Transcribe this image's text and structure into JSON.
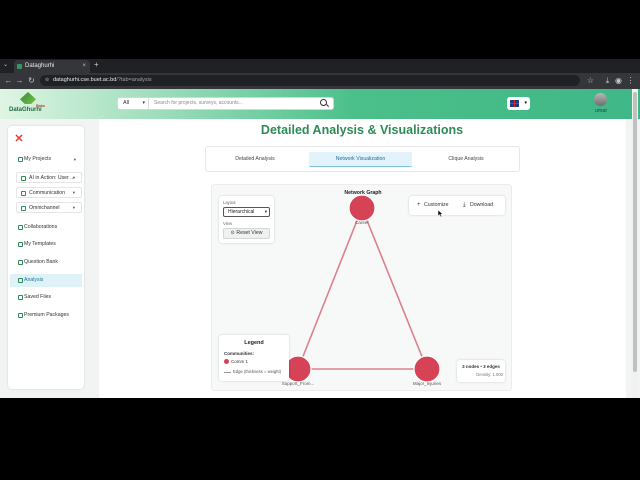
{
  "browser": {
    "tab_title": "Dataghurhi",
    "url_host": "dataghurhi.cse.buet.ac.bd",
    "url_path": "/?tab=analysis",
    "new_tab": "+"
  },
  "header": {
    "logo_name": "DataGhurhi",
    "logo_beta": "Beta",
    "search_category": "All",
    "search_placeholder": "Search for projects, surveys, accounts...",
    "username": "umar"
  },
  "sidebar": {
    "items": [
      {
        "label": "My Projects",
        "icon": "folder-icon",
        "dropdown": true
      },
      {
        "label": "AI in Action: User ...",
        "icon": "folder-icon",
        "dropdown": true,
        "sub": true
      },
      {
        "label": "Communication",
        "icon": "folder-icon",
        "dropdown": true,
        "sub": true
      },
      {
        "label": "Omnichannel",
        "icon": "folder-icon",
        "dropdown": true,
        "sub": true
      },
      {
        "label": "Collaborations",
        "icon": "users-icon"
      },
      {
        "label": "My Templates",
        "icon": "template-icon"
      },
      {
        "label": "Question Bank",
        "icon": "bank-icon"
      },
      {
        "label": "Analysis",
        "icon": "chart-icon",
        "active": true
      },
      {
        "label": "Saved Files",
        "icon": "file-icon"
      },
      {
        "label": "Premium Packages",
        "icon": "crown-icon"
      }
    ]
  },
  "main": {
    "title": "Detailed Analysis & Visualizations",
    "tabs": [
      {
        "label": "Detailed Analysis"
      },
      {
        "label": "Network Visualization",
        "active": true
      },
      {
        "label": "Clique Analysis"
      }
    ]
  },
  "graph": {
    "title": "Network Graph",
    "layout_label": "Layout",
    "layout_value": "Hierarchical",
    "view_label": "View",
    "reset_label": "⊙ Reset View",
    "customize_label": "Customize",
    "download_label": "Download",
    "legend_title": "Legend",
    "legend_communities": "Communities:",
    "legend_comm": "Comm 1",
    "legend_edge": "Edge (thickness = weight)",
    "stats_main": "3 nodes • 3 edges",
    "stats_density": "Density: 1.000",
    "node_color": "#d64256",
    "edge_color": "#d9828a",
    "nodes": [
      {
        "label": "Career"
      },
      {
        "label": "Support_From..."
      },
      {
        "label": "Major_Injuries"
      }
    ]
  }
}
